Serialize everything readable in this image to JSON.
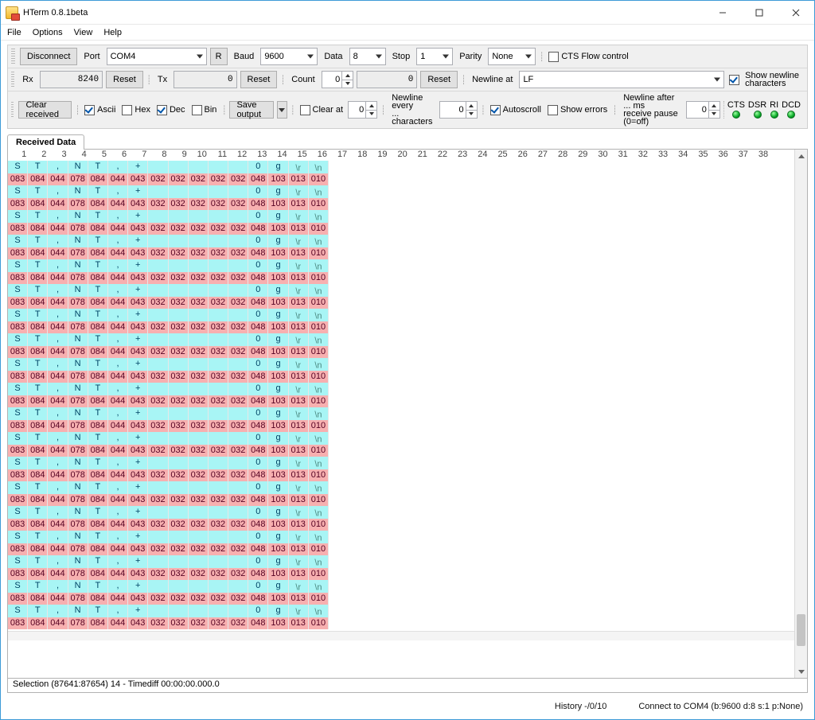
{
  "window": {
    "title": "HTerm 0.8.1beta"
  },
  "menu": {
    "file": "File",
    "options": "Options",
    "view": "View",
    "help": "Help"
  },
  "toolbar1": {
    "disconnect": "Disconnect",
    "port_label": "Port",
    "port_value": "COM4",
    "r": "R",
    "baud_label": "Baud",
    "baud_value": "9600",
    "data_label": "Data",
    "data_value": "8",
    "stop_label": "Stop",
    "stop_value": "1",
    "parity_label": "Parity",
    "parity_value": "None",
    "cts_label": "CTS Flow control",
    "cts_checked": false
  },
  "toolbar2": {
    "rx_label": "Rx",
    "rx_value": "8240",
    "rx_reset": "Reset",
    "tx_label": "Tx",
    "tx_value": "0",
    "tx_reset": "Reset",
    "count_label": "Count",
    "count_value": "0",
    "count_counter": "0",
    "count_reset": "Reset",
    "newline_at_label": "Newline at",
    "newline_at_value": "LF",
    "show_newline_l1": "Show newline",
    "show_newline_l2": "characters",
    "show_newline_checked": true
  },
  "toolbar3": {
    "clear_received": "Clear received",
    "ascii": "Ascii",
    "ascii_checked": true,
    "hex": "Hex",
    "hex_checked": false,
    "dec": "Dec",
    "dec_checked": true,
    "bin": "Bin",
    "bin_checked": false,
    "save_output": "Save output",
    "clear_at_label": "Clear at",
    "clear_at_checked": false,
    "clear_at_value": "0",
    "nl_every_l1": "Newline every",
    "nl_every_l2": "... characters",
    "nl_every_value": "0",
    "autoscroll": "Autoscroll",
    "autoscroll_checked": true,
    "show_errors": "Show errors",
    "show_errors_checked": false,
    "nl_after_l1": "Newline after ... ms",
    "nl_after_l2": "receive pause (0=off)",
    "nl_after_value": "0",
    "leds": [
      "CTS",
      "DSR",
      "RI",
      "DCD"
    ]
  },
  "tabs": {
    "received": "Received Data"
  },
  "ruler_start": 1,
  "ruler_end": 38,
  "block": {
    "ascii": [
      "S",
      "T",
      ",",
      "N",
      "T",
      ",",
      "+",
      " ",
      " ",
      " ",
      " ",
      " ",
      "0",
      "g",
      "\\r",
      "\\n"
    ],
    "dec": [
      "083",
      "084",
      "044",
      "078",
      "084",
      "044",
      "043",
      "032",
      "032",
      "032",
      "032",
      "032",
      "048",
      "103",
      "013",
      "010"
    ]
  },
  "block_repeats": 19,
  "selection_bar": "Selection (87641:87654) 14  -  Timediff 00:00:00.000.0",
  "status": {
    "history": "History -/0/10",
    "conn": "Connect to COM4 (b:9600 d:8 s:1 p:None)"
  }
}
